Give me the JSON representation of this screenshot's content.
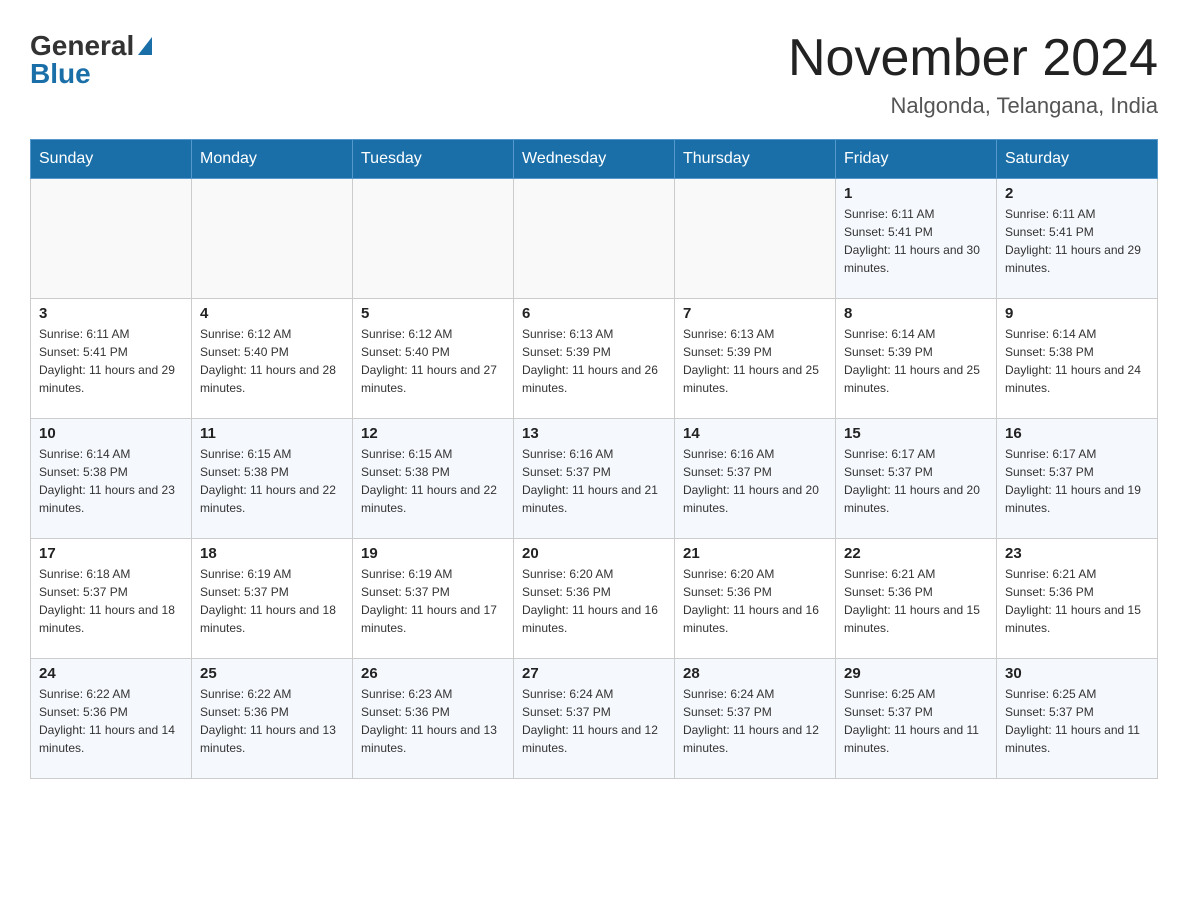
{
  "header": {
    "logo_general": "General",
    "logo_blue": "Blue",
    "month_title": "November 2024",
    "location": "Nalgonda, Telangana, India"
  },
  "days_of_week": [
    "Sunday",
    "Monday",
    "Tuesday",
    "Wednesday",
    "Thursday",
    "Friday",
    "Saturday"
  ],
  "weeks": [
    [
      {
        "date": "",
        "sunrise": "",
        "sunset": "",
        "daylight": ""
      },
      {
        "date": "",
        "sunrise": "",
        "sunset": "",
        "daylight": ""
      },
      {
        "date": "",
        "sunrise": "",
        "sunset": "",
        "daylight": ""
      },
      {
        "date": "",
        "sunrise": "",
        "sunset": "",
        "daylight": ""
      },
      {
        "date": "",
        "sunrise": "",
        "sunset": "",
        "daylight": ""
      },
      {
        "date": "1",
        "sunrise": "Sunrise: 6:11 AM",
        "sunset": "Sunset: 5:41 PM",
        "daylight": "Daylight: 11 hours and 30 minutes."
      },
      {
        "date": "2",
        "sunrise": "Sunrise: 6:11 AM",
        "sunset": "Sunset: 5:41 PM",
        "daylight": "Daylight: 11 hours and 29 minutes."
      }
    ],
    [
      {
        "date": "3",
        "sunrise": "Sunrise: 6:11 AM",
        "sunset": "Sunset: 5:41 PM",
        "daylight": "Daylight: 11 hours and 29 minutes."
      },
      {
        "date": "4",
        "sunrise": "Sunrise: 6:12 AM",
        "sunset": "Sunset: 5:40 PM",
        "daylight": "Daylight: 11 hours and 28 minutes."
      },
      {
        "date": "5",
        "sunrise": "Sunrise: 6:12 AM",
        "sunset": "Sunset: 5:40 PM",
        "daylight": "Daylight: 11 hours and 27 minutes."
      },
      {
        "date": "6",
        "sunrise": "Sunrise: 6:13 AM",
        "sunset": "Sunset: 5:39 PM",
        "daylight": "Daylight: 11 hours and 26 minutes."
      },
      {
        "date": "7",
        "sunrise": "Sunrise: 6:13 AM",
        "sunset": "Sunset: 5:39 PM",
        "daylight": "Daylight: 11 hours and 25 minutes."
      },
      {
        "date": "8",
        "sunrise": "Sunrise: 6:14 AM",
        "sunset": "Sunset: 5:39 PM",
        "daylight": "Daylight: 11 hours and 25 minutes."
      },
      {
        "date": "9",
        "sunrise": "Sunrise: 6:14 AM",
        "sunset": "Sunset: 5:38 PM",
        "daylight": "Daylight: 11 hours and 24 minutes."
      }
    ],
    [
      {
        "date": "10",
        "sunrise": "Sunrise: 6:14 AM",
        "sunset": "Sunset: 5:38 PM",
        "daylight": "Daylight: 11 hours and 23 minutes."
      },
      {
        "date": "11",
        "sunrise": "Sunrise: 6:15 AM",
        "sunset": "Sunset: 5:38 PM",
        "daylight": "Daylight: 11 hours and 22 minutes."
      },
      {
        "date": "12",
        "sunrise": "Sunrise: 6:15 AM",
        "sunset": "Sunset: 5:38 PM",
        "daylight": "Daylight: 11 hours and 22 minutes."
      },
      {
        "date": "13",
        "sunrise": "Sunrise: 6:16 AM",
        "sunset": "Sunset: 5:37 PM",
        "daylight": "Daylight: 11 hours and 21 minutes."
      },
      {
        "date": "14",
        "sunrise": "Sunrise: 6:16 AM",
        "sunset": "Sunset: 5:37 PM",
        "daylight": "Daylight: 11 hours and 20 minutes."
      },
      {
        "date": "15",
        "sunrise": "Sunrise: 6:17 AM",
        "sunset": "Sunset: 5:37 PM",
        "daylight": "Daylight: 11 hours and 20 minutes."
      },
      {
        "date": "16",
        "sunrise": "Sunrise: 6:17 AM",
        "sunset": "Sunset: 5:37 PM",
        "daylight": "Daylight: 11 hours and 19 minutes."
      }
    ],
    [
      {
        "date": "17",
        "sunrise": "Sunrise: 6:18 AM",
        "sunset": "Sunset: 5:37 PM",
        "daylight": "Daylight: 11 hours and 18 minutes."
      },
      {
        "date": "18",
        "sunrise": "Sunrise: 6:19 AM",
        "sunset": "Sunset: 5:37 PM",
        "daylight": "Daylight: 11 hours and 18 minutes."
      },
      {
        "date": "19",
        "sunrise": "Sunrise: 6:19 AM",
        "sunset": "Sunset: 5:37 PM",
        "daylight": "Daylight: 11 hours and 17 minutes."
      },
      {
        "date": "20",
        "sunrise": "Sunrise: 6:20 AM",
        "sunset": "Sunset: 5:36 PM",
        "daylight": "Daylight: 11 hours and 16 minutes."
      },
      {
        "date": "21",
        "sunrise": "Sunrise: 6:20 AM",
        "sunset": "Sunset: 5:36 PM",
        "daylight": "Daylight: 11 hours and 16 minutes."
      },
      {
        "date": "22",
        "sunrise": "Sunrise: 6:21 AM",
        "sunset": "Sunset: 5:36 PM",
        "daylight": "Daylight: 11 hours and 15 minutes."
      },
      {
        "date": "23",
        "sunrise": "Sunrise: 6:21 AM",
        "sunset": "Sunset: 5:36 PM",
        "daylight": "Daylight: 11 hours and 15 minutes."
      }
    ],
    [
      {
        "date": "24",
        "sunrise": "Sunrise: 6:22 AM",
        "sunset": "Sunset: 5:36 PM",
        "daylight": "Daylight: 11 hours and 14 minutes."
      },
      {
        "date": "25",
        "sunrise": "Sunrise: 6:22 AM",
        "sunset": "Sunset: 5:36 PM",
        "daylight": "Daylight: 11 hours and 13 minutes."
      },
      {
        "date": "26",
        "sunrise": "Sunrise: 6:23 AM",
        "sunset": "Sunset: 5:36 PM",
        "daylight": "Daylight: 11 hours and 13 minutes."
      },
      {
        "date": "27",
        "sunrise": "Sunrise: 6:24 AM",
        "sunset": "Sunset: 5:37 PM",
        "daylight": "Daylight: 11 hours and 12 minutes."
      },
      {
        "date": "28",
        "sunrise": "Sunrise: 6:24 AM",
        "sunset": "Sunset: 5:37 PM",
        "daylight": "Daylight: 11 hours and 12 minutes."
      },
      {
        "date": "29",
        "sunrise": "Sunrise: 6:25 AM",
        "sunset": "Sunset: 5:37 PM",
        "daylight": "Daylight: 11 hours and 11 minutes."
      },
      {
        "date": "30",
        "sunrise": "Sunrise: 6:25 AM",
        "sunset": "Sunset: 5:37 PM",
        "daylight": "Daylight: 11 hours and 11 minutes."
      }
    ]
  ]
}
